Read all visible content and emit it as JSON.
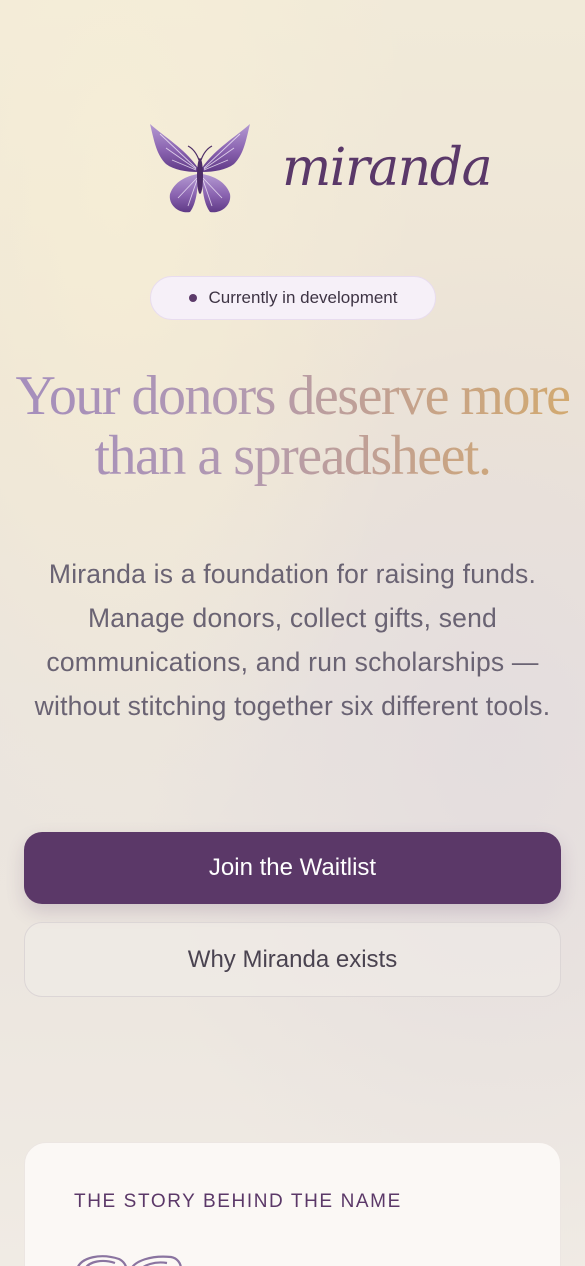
{
  "brand": {
    "name": "miranda",
    "logo_icon": "butterfly-icon"
  },
  "badge": {
    "text": "Currently in development"
  },
  "hero": {
    "headline_line1": "Your donors deserve more",
    "headline_line2": "than a spreadsheet.",
    "description": "Miranda is a foundation for raising funds. Manage donors, collect gifts, send communications, and run scholarships — without stitching together six different tools."
  },
  "actions": {
    "primary_label": "Join the Waitlist",
    "secondary_label": "Why Miranda exists"
  },
  "story": {
    "label": "THE STORY BEHIND THE NAME",
    "icon": "butterfly-icon"
  },
  "colors": {
    "brand_purple": "#5b3868",
    "headline_gradient_start": "#a48dbd",
    "headline_gradient_end": "#d3aa6e"
  }
}
